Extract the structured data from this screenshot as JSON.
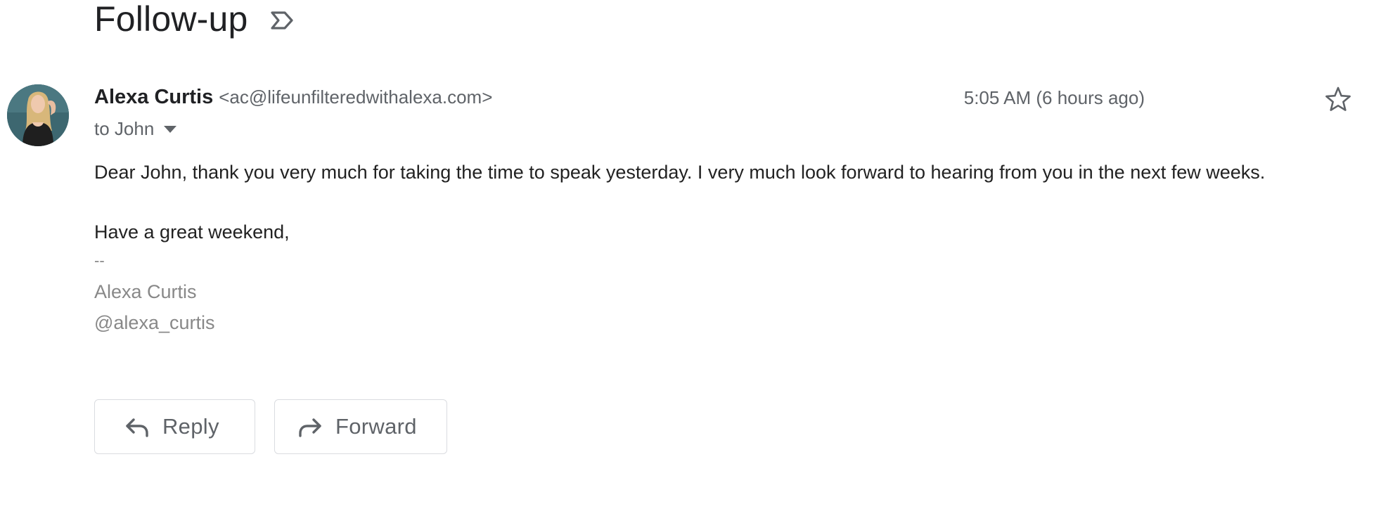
{
  "email": {
    "subject": "Follow-up",
    "sender_name": "Alexa Curtis",
    "sender_email": "<ac@lifeunfilteredwithalexa.com>",
    "recipient_text": "to John",
    "timestamp": "5:05 AM (6 hours ago)",
    "body_lines": [
      "Dear John, thank you very much for taking the time to speak yesterday. I very much look forward to hearing from you in the next few weeks.",
      "Have a great weekend,"
    ],
    "signature": {
      "separator": "--",
      "name": "Alexa Curtis",
      "handle": "@alexa_curtis"
    }
  },
  "actions": {
    "reply_label": "Reply",
    "forward_label": "Forward"
  },
  "icons": {
    "label": "label-outline-icon",
    "star": "star-outline-icon",
    "caret": "caret-down-icon",
    "reply": "reply-icon",
    "forward": "forward-icon"
  },
  "colors": {
    "text_primary": "#202124",
    "text_secondary": "#5f6368",
    "signature_gray": "#888888",
    "border": "#dadce0"
  }
}
